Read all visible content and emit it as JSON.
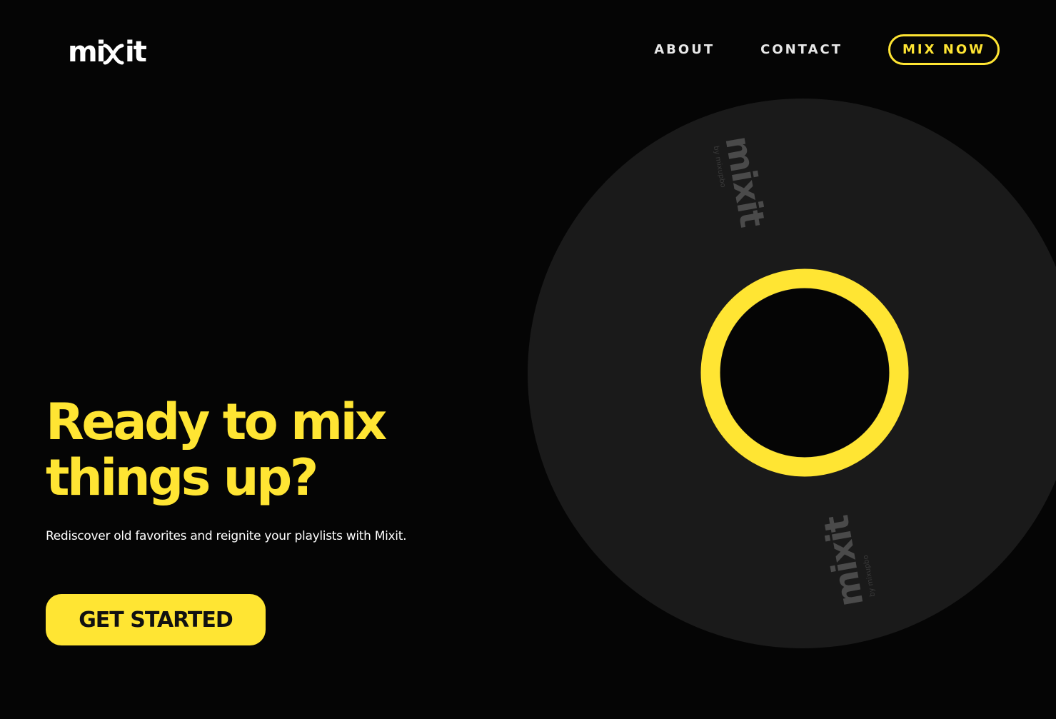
{
  "brand": {
    "logo_text": "mixit",
    "accent_color": "#ffe533",
    "background_color": "#050505"
  },
  "nav": {
    "about": "ABOUT",
    "contact": "CONTACT",
    "cta": "MIX NOW"
  },
  "hero": {
    "headline_line1": "Ready to mix",
    "headline_line2": "things up?",
    "subtext": "Rediscover old favorites and reignite your playlists with Mixit.",
    "cta": "GET STARTED"
  },
  "disc": {
    "label_text": "mixit",
    "label_subtext": "by mixupbo",
    "disc_color": "#1a1a1a",
    "ring_color": "#ffe533"
  }
}
